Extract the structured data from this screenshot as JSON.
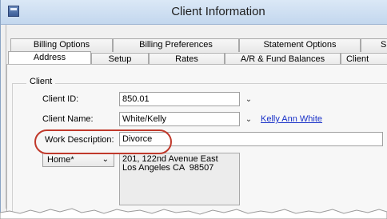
{
  "window": {
    "title": "Client Information",
    "icon": "app-window-icon"
  },
  "tabs_row1": [
    {
      "label": "Billing Options"
    },
    {
      "label": "Billing Preferences"
    },
    {
      "label": "Statement Options"
    },
    {
      "label": "S"
    }
  ],
  "tabs_row2": [
    {
      "label": "Address",
      "active": true
    },
    {
      "label": "Setup"
    },
    {
      "label": "Rates"
    },
    {
      "label": "A/R & Fund Balances"
    },
    {
      "label": "Client"
    }
  ],
  "client_group": {
    "legend": "Client",
    "client_id_label": "Client ID:",
    "client_id_value": "850.01",
    "client_name_label": "Client Name:",
    "client_name_value": "White/Kelly",
    "client_name_link": "Kelly Ann White",
    "work_description_label": "Work Description:",
    "work_description_value": "Divorce",
    "address_type": "Home*",
    "address_line1": "201, 122nd Avenue East",
    "address_line2": "Los Angeles CA  98507"
  },
  "colors": {
    "highlight": "#c0392b",
    "link": "#1a32c8",
    "titlebar": "#c3d7ee"
  }
}
